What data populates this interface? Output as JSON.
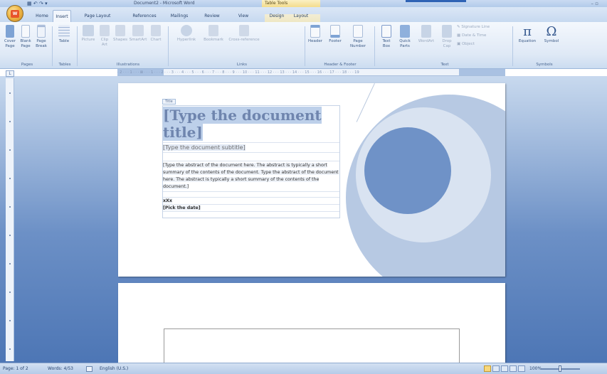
{
  "window": {
    "title": "Document2 - Microsoft Word",
    "contextual_title": "Table Tools",
    "controls": "–  ▫"
  },
  "quick_access": "▾",
  "tabs": [
    {
      "label": "Home"
    },
    {
      "label": "Insert"
    },
    {
      "label": "Page Layout"
    },
    {
      "label": "References"
    },
    {
      "label": "Mailings"
    },
    {
      "label": "Review"
    },
    {
      "label": "View"
    },
    {
      "label": "Design"
    },
    {
      "label": "Layout"
    }
  ],
  "active_tab": "Insert",
  "ribbon": {
    "pages": {
      "group": "Pages",
      "cover_page": "Cover Page",
      "blank_page": "Blank Page",
      "page_break": "Page Break"
    },
    "tables": {
      "group": "Tables",
      "table": "Table"
    },
    "illustrations": {
      "group": "Illustrations",
      "picture": "Picture",
      "clip_art": "Clip Art",
      "shapes": "Shapes",
      "smartart": "SmartArt",
      "chart": "Chart"
    },
    "links": {
      "group": "Links",
      "hyperlink": "Hyperlink",
      "bookmark": "Bookmark",
      "cross_reference": "Cross-reference"
    },
    "header_footer": {
      "group": "Header & Footer",
      "header": "Header",
      "footer": "Footer",
      "page_number": "Page Number"
    },
    "text": {
      "group": "Text",
      "text_box": "Text Box",
      "quick_parts": "Quick Parts",
      "wordart": "WordArt",
      "drop_cap": "Drop Cap",
      "signature_line": "Signature Line",
      "date_time": "Date & Time",
      "object": "Object"
    },
    "symbols": {
      "group": "Symbols",
      "equation": "Equation",
      "symbol": "Symbol"
    }
  },
  "ruler_marks": "· 2 · · · 1 · · · ⊠ · · · 1 · · · 2 · · · 3 · · · 4 · · · 5 · · · 6 · · · 7 · · · 8 · · · 9 · · · 10 · · · 11 · · · 12 · · · 13 · · · 14 · · · 15 · · · 16 · · · 17 · · · 18 · · · 19",
  "document": {
    "content_control_label": "Title",
    "title": "[Type the document title]",
    "subtitle": "[Type the document subtitle]",
    "abstract": "[Type the abstract of the document here. The abstract is typically a short summary of the contents of the document. Type the abstract of the document here. The abstract is typically a short summary of the contents of the document.]",
    "author": "xXx",
    "date": "[Pick the date]"
  },
  "statusbar": {
    "page": "Page: 1 of 2",
    "words": "Words: 4/53",
    "language": "English (U.S.)",
    "zoom": "100%"
  },
  "colors": {
    "accent": "#2f63b5",
    "cover_circle_dark": "#6f92c7",
    "cover_circle_mid": "#b7c9e3",
    "cover_circle_light": "#d9e3f1",
    "title_text": "#6f85ae"
  }
}
